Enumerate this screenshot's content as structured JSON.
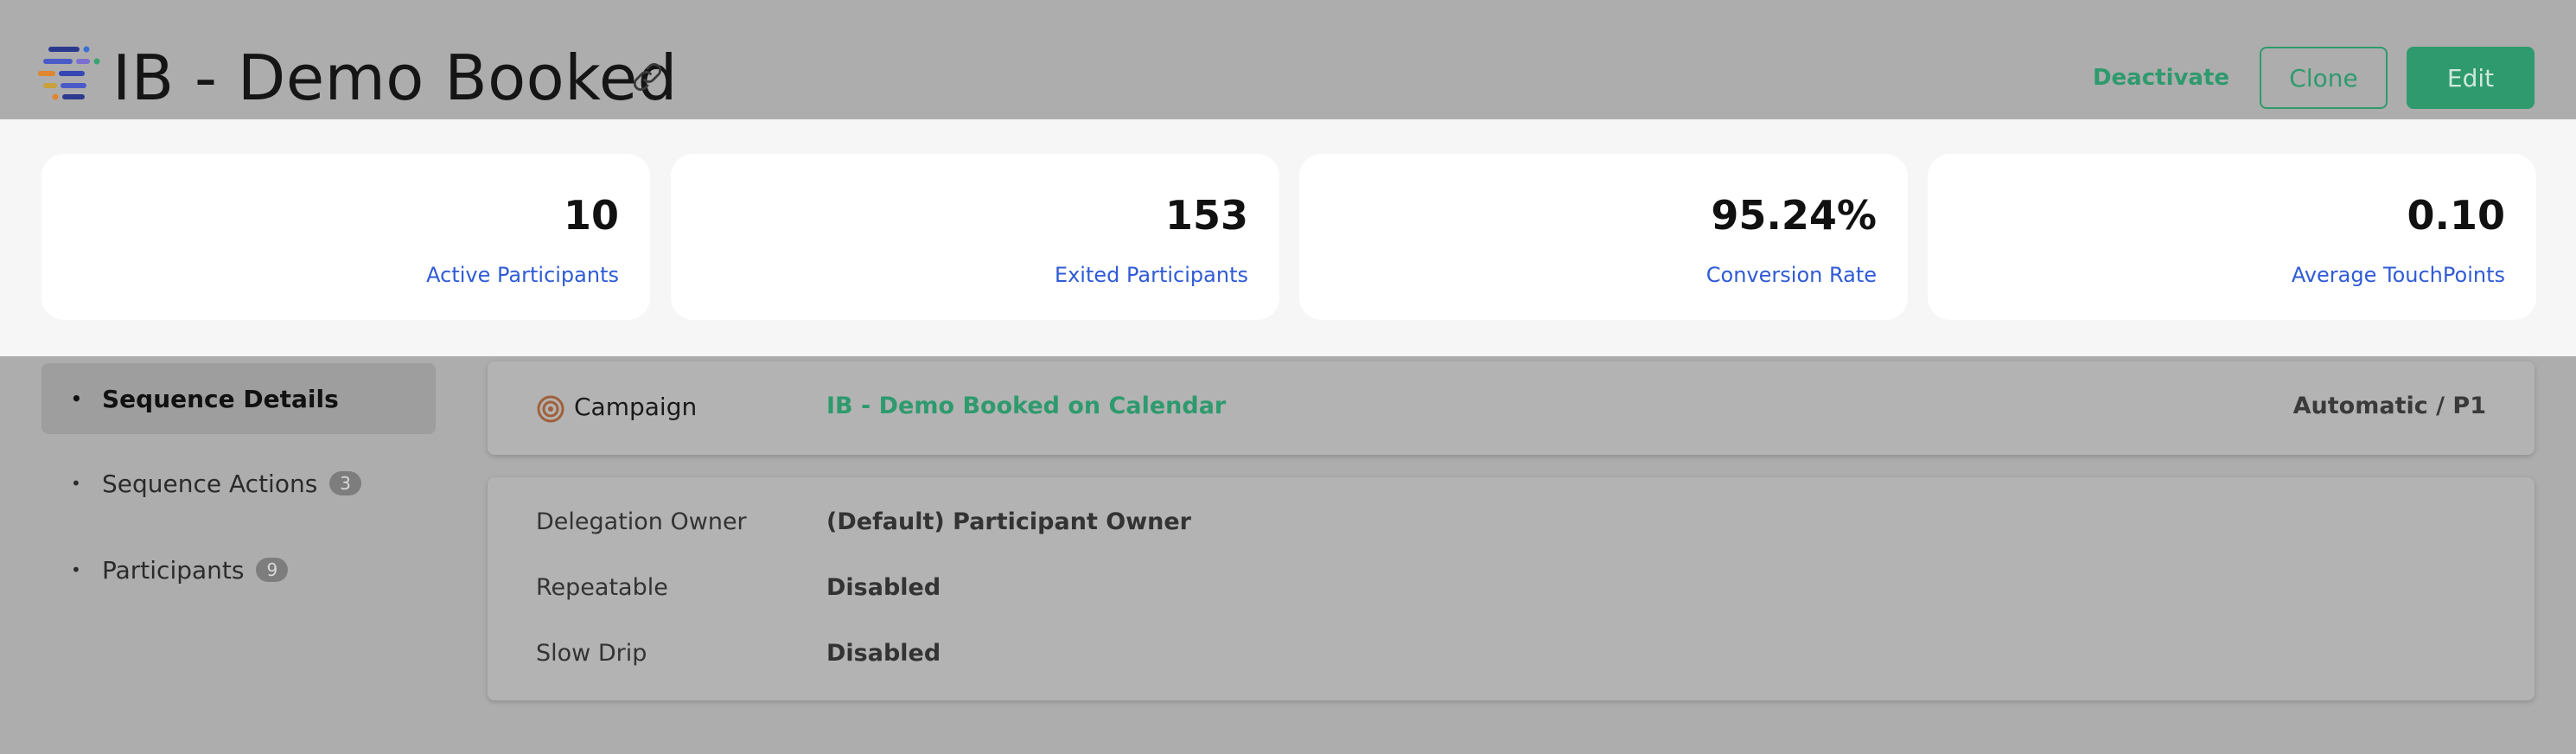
{
  "header": {
    "title": "IB - Demo Booked",
    "deactivate_label": "Deactivate",
    "clone_label": "Clone",
    "edit_label": "Edit"
  },
  "stats": [
    {
      "value": "10",
      "label": "Active Participants"
    },
    {
      "value": "153",
      "label": "Exited Participants"
    },
    {
      "value": "95.24%",
      "label": "Conversion Rate"
    },
    {
      "value": "0.10",
      "label": "Average TouchPoints"
    }
  ],
  "sidebar": {
    "items": [
      {
        "label": "Sequence Details",
        "badge": ""
      },
      {
        "label": "Sequence Actions",
        "badge": "3"
      },
      {
        "label": "Participants",
        "badge": "9"
      }
    ]
  },
  "campaign": {
    "label": "Campaign",
    "value": "IB - Demo Booked on Calendar",
    "mode": "Automatic / P1"
  },
  "details": [
    {
      "label": "Delegation Owner",
      "value": "(Default) Participant Owner"
    },
    {
      "label": "Repeatable",
      "value": "Disabled"
    },
    {
      "label": "Slow Drip",
      "value": "Disabled"
    }
  ],
  "colors": {
    "accent": "#2e9a6e",
    "link_blue": "#2f5bd6",
    "overlay_gray": "#adadad",
    "stats_band": "#f6f6f6"
  },
  "icons": {
    "logo": "app-logo-icon",
    "link": "link-icon",
    "campaign": "target-icon"
  }
}
